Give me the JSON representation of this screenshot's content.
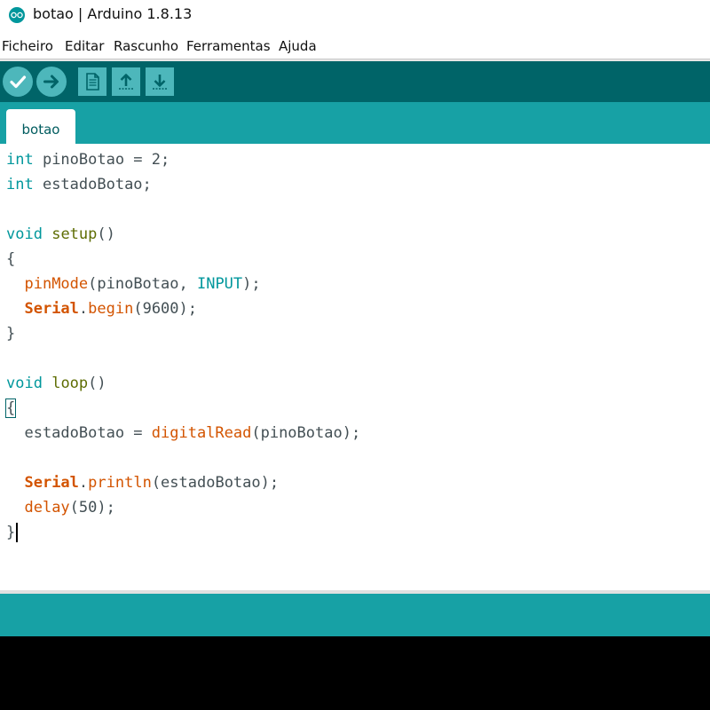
{
  "window": {
    "title": "botao | Arduino 1.8.13"
  },
  "menu": [
    "Ficheiro",
    "Editar",
    "Rascunho",
    "Ferramentas",
    "Ajuda"
  ],
  "toolbar": {
    "buttons": [
      {
        "name": "verify",
        "icon": "checkmark-icon"
      },
      {
        "name": "upload",
        "icon": "arrow-right-icon"
      },
      {
        "name": "new",
        "icon": "new-file-icon"
      },
      {
        "name": "open",
        "icon": "arrow-up-icon"
      },
      {
        "name": "save",
        "icon": "arrow-down-icon"
      }
    ]
  },
  "tabs": [
    {
      "label": "botao",
      "active": true
    }
  ],
  "code": {
    "line1": {
      "kw": "int",
      "rest": " pinoBotao = 2;"
    },
    "line2": {
      "kw": "int",
      "rest": " estadoBotao;"
    },
    "line4": {
      "kw": "void",
      "fn": "setup",
      "rest": "()"
    },
    "line5": {
      "text": "{"
    },
    "line6": {
      "indent": "  ",
      "fn": "pinMode",
      "open": "(pinoBotao, ",
      "const": "INPUT",
      "close": ");"
    },
    "line7": {
      "indent": "  ",
      "obj": "Serial",
      "dot": ".",
      "fn": "begin",
      "rest": "(9600);"
    },
    "line8": {
      "text": "}"
    },
    "line10": {
      "kw": "void",
      "fn": "loop",
      "rest": "()"
    },
    "line11": {
      "text": "{"
    },
    "line12": {
      "indent": "  estadoBotao = ",
      "fn": "digitalRead",
      "rest": "(pinoBotao);"
    },
    "line14": {
      "indent": "  ",
      "obj": "Serial",
      "dot": ".",
      "fn": "println",
      "rest": "(estadoBotao);"
    },
    "line15": {
      "indent": "  ",
      "fn": "delay",
      "rest": "(50);"
    },
    "line16": {
      "text": "}"
    }
  },
  "colors": {
    "toolbar": "#006468",
    "tabbar": "#17a1a5",
    "button": "#4db7bb",
    "keyword": "#00979c",
    "function": "#d35400",
    "text": "#434f54"
  }
}
